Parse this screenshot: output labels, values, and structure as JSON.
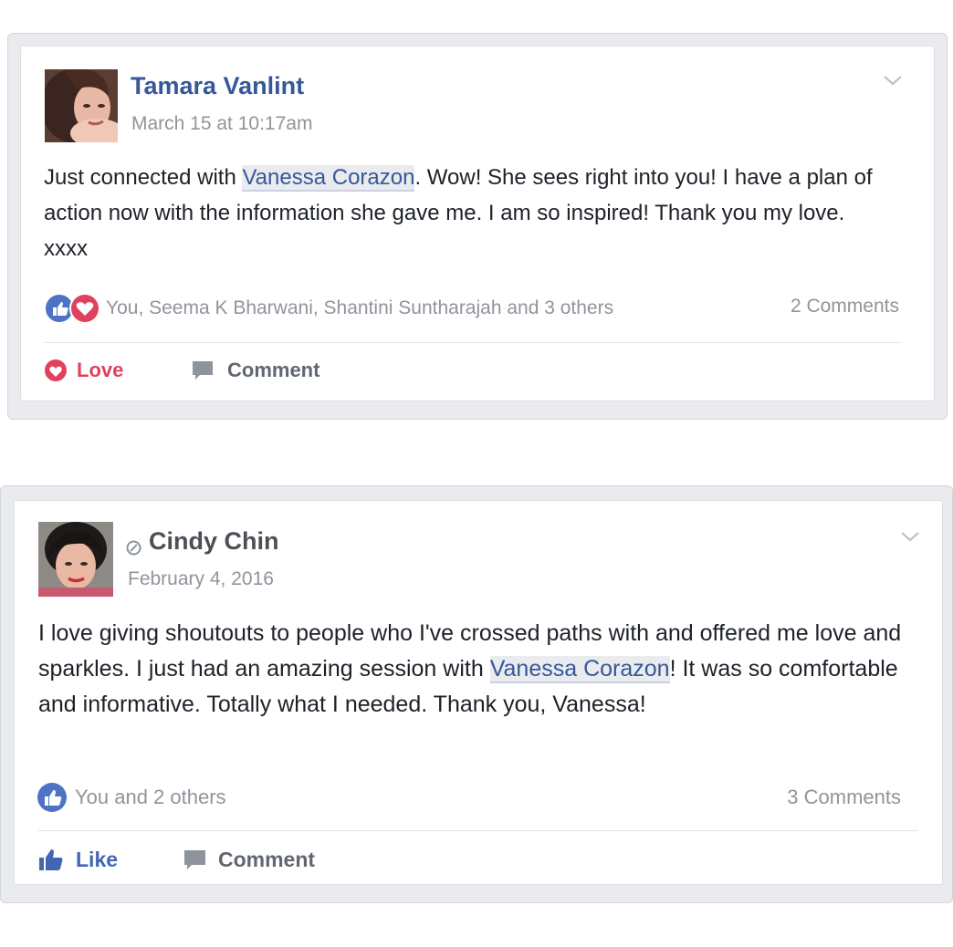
{
  "posts": [
    {
      "author": "Tamara Vanlint",
      "timestamp": "March 15 at 10:17am",
      "text_before": "Just connected with ",
      "mention": "Vanessa Corazon",
      "text_after": ". Wow! She sees right into you! I have a plan of action now with the information she gave me. I am so inspired! Thank you my love. xxxx",
      "reactions_summary": "You, Seema K Bharwani, Shantini Suntharajah and 3 others",
      "comments_count": "2 Comments",
      "primary_action": "Love",
      "comment_action": "Comment",
      "reaction_icons": [
        "like-icon",
        "love-icon"
      ]
    },
    {
      "author": "Cindy Chin",
      "timestamp": "February 4, 2016",
      "text_before": "I love giving shoutouts to people who I've crossed paths with and offered me love and sparkles. I just had an amazing session with ",
      "mention": "Vanessa Corazon",
      "text_after": "! It was so comfortable and informative. Totally what I needed. Thank you, Vanessa!",
      "reactions_summary": "You and 2 others",
      "comments_count": "3 Comments",
      "primary_action": "Like",
      "comment_action": "Comment",
      "reaction_icons": [
        "like-icon"
      ]
    }
  ],
  "colors": {
    "link_blue": "#365899",
    "like_blue": "#4267b2",
    "love_red": "#e0425d",
    "muted_gray": "#90949c",
    "action_gray": "#616770"
  }
}
